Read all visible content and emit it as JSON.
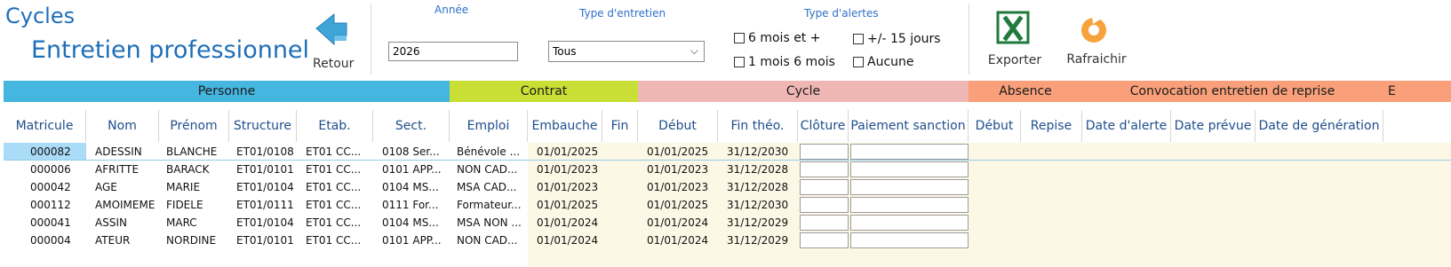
{
  "title": {
    "line1": "Cycles",
    "line2": "Entretien professionnel"
  },
  "toolbar": {
    "retour_label": "Retour",
    "annee_label": "Année",
    "annee_value": "2026",
    "type_entretien_label": "Type d'entretien",
    "type_entretien_value": "Tous",
    "type_alertes_label": "Type d'alertes",
    "alerts": [
      "6 mois et +",
      "+/- 15 jours",
      "1 mois 6 mois",
      "Aucune"
    ],
    "exporter_label": "Exporter",
    "rafraichir_label": "Rafraichir"
  },
  "groups": [
    "Personne",
    "Contrat",
    "Cycle",
    "Absence",
    "Convocation entretien de reprise",
    "E"
  ],
  "columns": [
    "Matricule",
    "Nom",
    "Prénom",
    "Structure",
    "Etab.",
    "Sect.",
    "Emploi",
    "Embauche",
    "Fin",
    "Début",
    "Fin théo.",
    "Clôture",
    "Paiement sanction",
    "Début",
    "Repise",
    "Date d'alerte",
    "Date prévue",
    "Date de génération"
  ],
  "rows": [
    [
      "000082",
      "ADESSIN",
      "BLANCHE",
      "ET01/0108",
      "ET01 CC...",
      "0108 Ser...",
      "Bénévole ...",
      "01/01/2025",
      "",
      "01/01/2025",
      "31/12/2030"
    ],
    [
      "000006",
      "AFRITTE",
      "BARACK",
      "ET01/0101",
      "ET01 CC...",
      "0101 APP...",
      "NON CAD...",
      "01/01/2023",
      "",
      "01/01/2023",
      "31/12/2028"
    ],
    [
      "000042",
      "AGE",
      "MARIE",
      "ET01/0104",
      "ET01 CC...",
      "0104 MS...",
      "MSA CAD...",
      "01/01/2023",
      "",
      "01/01/2023",
      "31/12/2028"
    ],
    [
      "000112",
      "AMOIMEME",
      "FIDELE",
      "ET01/0111",
      "ET01 CC...",
      "0111 For...",
      "Formateur...",
      "01/01/2025",
      "",
      "01/01/2025",
      "31/12/2030"
    ],
    [
      "000041",
      "ASSIN",
      "MARC",
      "ET01/0104",
      "ET01 CC...",
      "0104 MS...",
      "MSA NON ...",
      "01/01/2024",
      "",
      "01/01/2024",
      "31/12/2029"
    ],
    [
      "000004",
      "ATEUR",
      "NORDINE",
      "ET01/0101",
      "ET01 CC...",
      "0101 APP...",
      "NON CAD...",
      "01/01/2024",
      "",
      "01/01/2024",
      "31/12/2029"
    ]
  ],
  "colors": {
    "title": "#1e6fb8",
    "personne": "#45b6e0",
    "contrat": "#c9df35",
    "cycle": "#efb7b3",
    "absence": "#f9a07b",
    "convocation": "#f9a07b",
    "selected": "#aadbf7",
    "cream": "#fdf7e6"
  }
}
